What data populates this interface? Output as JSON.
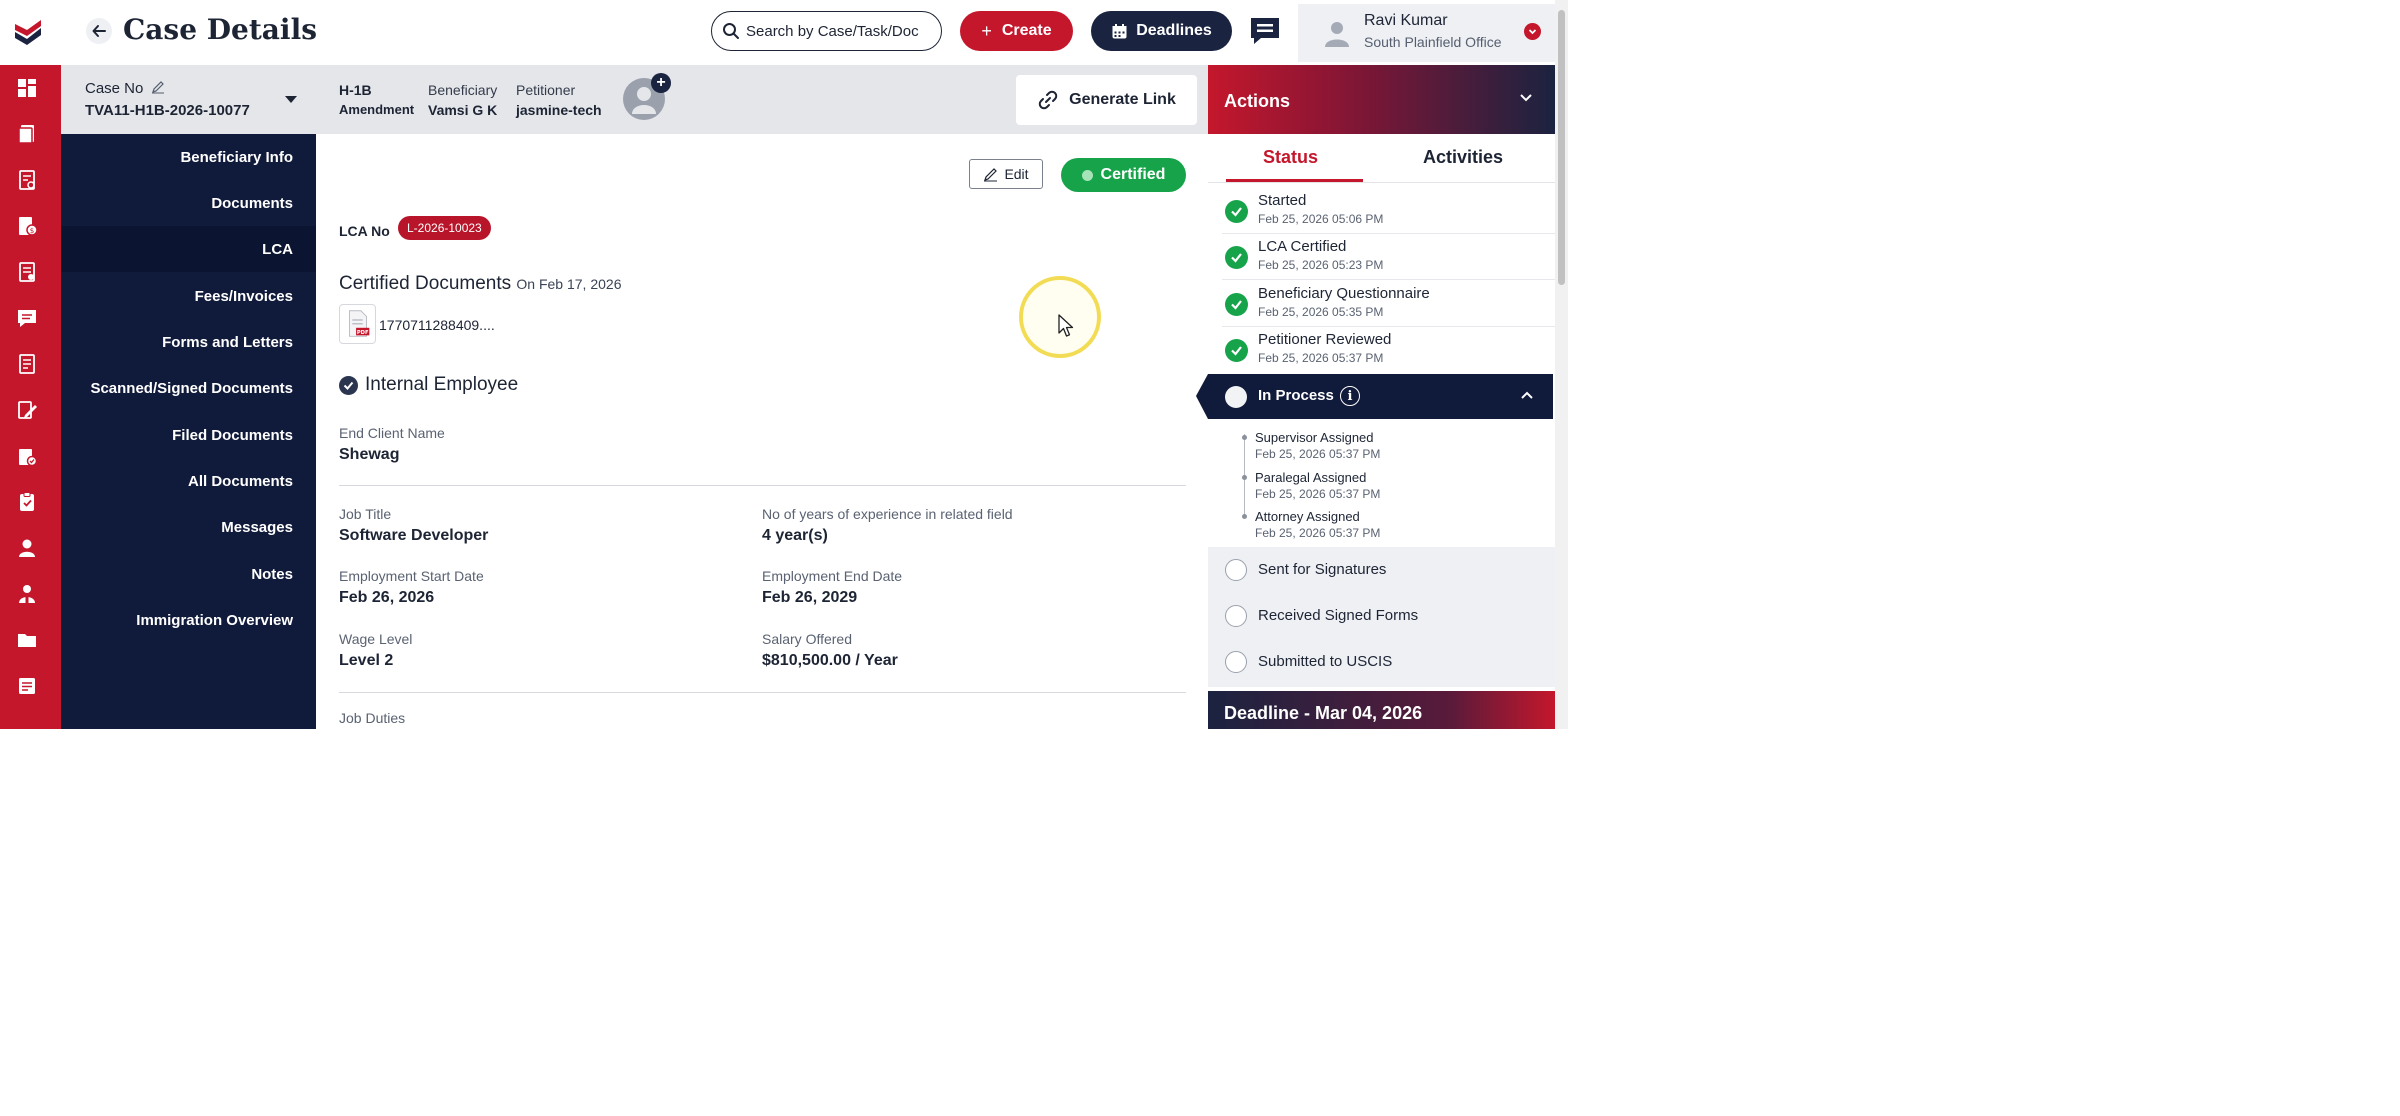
{
  "header": {
    "title": "Case Details",
    "search_placeholder": "Search by Case/Task/Doc",
    "create_label": "Create",
    "deadlines_label": "Deadlines",
    "user": {
      "name": "Ravi Kumar",
      "office": "South Plainfield Office"
    }
  },
  "rail": {
    "icons": [
      "dashboard-icon",
      "cases-icon",
      "forms-icon",
      "fees-icon",
      "documents-icon",
      "messages-icon",
      "notes-icon",
      "edit-forms-icon",
      "checklist-icon",
      "clipboard-icon",
      "user-icon",
      "people-icon",
      "folder-icon",
      "reports-icon"
    ]
  },
  "case": {
    "case_no_label": "Case No",
    "case_no_value": "TVA11-H1B-2026-10077",
    "visa_type": "H-1B",
    "visa_sub": "Amendment",
    "beneficiary_label": "Beneficiary",
    "beneficiary_value": "Vamsi G K",
    "petitioner_label": "Petitioner",
    "petitioner_value": "jasmine-tech",
    "generate_link_label": "Generate Link"
  },
  "section_nav": {
    "items": [
      "Beneficiary Info",
      "Documents",
      "LCA",
      "Fees/Invoices",
      "Forms and Letters",
      "Scanned/Signed Documents",
      "Filed Documents",
      "All Documents",
      "Messages",
      "Notes",
      "Immigration Overview"
    ],
    "active": "LCA"
  },
  "lca": {
    "edit_label": "Edit",
    "status_label": "Certified",
    "lca_no_label": "LCA No",
    "lca_no_value": "L-2026-10023",
    "certified_docs_title": "Certified Documents",
    "certified_docs_date": "On Feb 17, 2026",
    "file_name": "1770711288409....",
    "internal_employee_label": "Internal Employee",
    "end_client_label": "End Client Name",
    "end_client_value": "Shewag",
    "job_title_label": "Job Title",
    "job_title_value": "Software Developer",
    "experience_label": "No of years of experience in related field",
    "experience_value": "4 year(s)",
    "start_date_label": "Employment Start Date",
    "start_date_value": "Feb 26, 2026",
    "end_date_label": "Employment End Date",
    "end_date_value": "Feb 26, 2029",
    "wage_level_label": "Wage Level",
    "wage_level_value": "Level 2",
    "salary_label": "Salary Offered",
    "salary_value": "$810,500.00 / Year",
    "job_duties_label": "Job Duties"
  },
  "actions": {
    "title": "Actions",
    "tabs": [
      "Status",
      "Activities"
    ],
    "completed_steps": [
      {
        "title": "Started",
        "date": "Feb 25, 2026 05:06 PM"
      },
      {
        "title": "LCA Certified",
        "date": "Feb 25, 2026 05:23 PM"
      },
      {
        "title": "Beneficiary Questionnaire",
        "date": "Feb 25, 2026 05:35 PM"
      },
      {
        "title": "Petitioner Reviewed",
        "date": "Feb 25, 2026 05:37 PM"
      }
    ],
    "current_step": "In Process",
    "sub_steps": [
      {
        "title": "Supervisor Assigned",
        "date": "Feb 25, 2026 05:37 PM"
      },
      {
        "title": "Paralegal Assigned",
        "date": "Feb 25, 2026 05:37 PM"
      },
      {
        "title": "Attorney Assigned",
        "date": "Feb 25, 2026 05:37 PM"
      }
    ],
    "pending_steps": [
      "Sent for Signatures",
      "Received Signed Forms",
      "Submitted to USCIS"
    ],
    "deadline": "Deadline - Mar 04, 2026"
  },
  "colors": {
    "brand_red": "#c4172c",
    "navy": "#1a2340",
    "nav_bg": "#101a3a",
    "success": "#16a34a"
  }
}
